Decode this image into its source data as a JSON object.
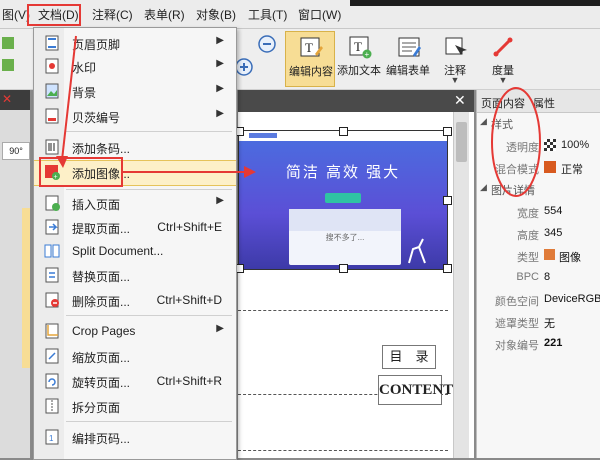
{
  "menubar": {
    "items": [
      "图(V)",
      "文档(D)",
      "注释(C)",
      "表单(R)",
      "对象(B)",
      "工具(T)",
      "窗口(W)"
    ]
  },
  "toolbar": {
    "buttons": [
      {
        "label": "编辑内容",
        "icon": "edit-content-icon"
      },
      {
        "label": "添加文本",
        "icon": "add-text-icon"
      },
      {
        "label": "编辑表单",
        "icon": "edit-form-icon"
      },
      {
        "label": "注释",
        "icon": "annotation-icon"
      },
      {
        "label": "度量",
        "icon": "measure-icon"
      }
    ]
  },
  "left_strip": {
    "zoom": "90°"
  },
  "doc_menu": {
    "items": [
      {
        "label": "页眉页脚",
        "shortcut": "",
        "submenu": true
      },
      {
        "label": "水印",
        "shortcut": "",
        "submenu": true
      },
      {
        "label": "背景",
        "shortcut": "",
        "submenu": true
      },
      {
        "label": "贝茨编号",
        "shortcut": "",
        "submenu": true
      },
      {
        "label": "添加条码...",
        "shortcut": "",
        "submenu": false
      },
      {
        "label": "添加图像...",
        "shortcut": "",
        "submenu": false
      },
      {
        "label": "插入页面",
        "shortcut": "",
        "submenu": true
      },
      {
        "label": "提取页面...",
        "shortcut": "Ctrl+Shift+E",
        "submenu": false
      },
      {
        "label": "Split Document...",
        "shortcut": "",
        "submenu": false
      },
      {
        "label": "替换页面...",
        "shortcut": "",
        "submenu": false
      },
      {
        "label": "删除页面...",
        "shortcut": "Ctrl+Shift+D",
        "submenu": false
      },
      {
        "label": "Crop Pages",
        "shortcut": "",
        "submenu": true
      },
      {
        "label": "缩放页面...",
        "shortcut": "",
        "submenu": false
      },
      {
        "label": "旋转页面...",
        "shortcut": "Ctrl+Shift+R",
        "submenu": false
      },
      {
        "label": "拆分页面",
        "shortcut": "",
        "submenu": false
      },
      {
        "label": "编排页码...",
        "shortcut": "",
        "submenu": false
      }
    ]
  },
  "banner": {
    "headline": "简洁 高效 强大",
    "search_text": "搜不多了..."
  },
  "page": {
    "toc_title": "目　录",
    "content_title": "CONTENT"
  },
  "right_panel": {
    "tabs": [
      "页面内容",
      "属性"
    ],
    "section_style": "样式",
    "opacity_label": "透明度",
    "opacity_value": "100%",
    "blend_label": "混合模式",
    "blend_value": "正常",
    "section_image": "图片详情",
    "rows": [
      {
        "key": "宽度",
        "value": "554"
      },
      {
        "key": "高度",
        "value": "345"
      },
      {
        "key": "类型",
        "value": "图像"
      },
      {
        "key": "BPC",
        "value": "8"
      },
      {
        "key": "颜色空间",
        "value": "DeviceRGB"
      },
      {
        "key": "遮罩类型",
        "value": "无"
      },
      {
        "key": "对象编号",
        "value": "221"
      }
    ]
  },
  "colors": {
    "highlight_red": "#e53935",
    "menu_hover": "#fdf0c8",
    "banner": "#4a5fdc",
    "accent_arrow": "#e53935"
  }
}
